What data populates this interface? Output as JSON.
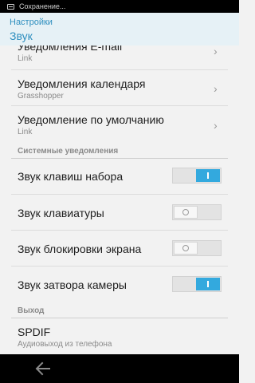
{
  "status_bar": {
    "notification_text": "Сохранение..."
  },
  "action_bar": {
    "parent_title": "Настройки",
    "title": "Звук"
  },
  "items": [
    {
      "title": "Уведомления E-mail",
      "subtitle": "Link",
      "has_chevron": true
    },
    {
      "title": "Уведомления календаря",
      "subtitle": "Grasshopper",
      "has_chevron": true
    },
    {
      "title": "Уведомление по умолчанию",
      "subtitle": "Link",
      "has_chevron": true
    }
  ],
  "system_section": {
    "header": "Системные уведомления",
    "toggles": [
      {
        "title": "Звук клавиш набора",
        "on": true
      },
      {
        "title": "Звук клавиатуры",
        "on": false
      },
      {
        "title": "Звук блокировки экрана",
        "on": false
      },
      {
        "title": "Звук затвора камеры",
        "on": true
      }
    ]
  },
  "output_section": {
    "header": "Выход",
    "item": {
      "title": "SPDIF",
      "subtitle": "Аудиовыход из телефона"
    }
  },
  "colors": {
    "accent": "#33a9de",
    "title_blue": "#2f8fbf",
    "actionbar_bg": "#e6f1f6"
  },
  "icons": {
    "chevron": "chevron-right-icon",
    "back": "back-arrow-icon"
  }
}
